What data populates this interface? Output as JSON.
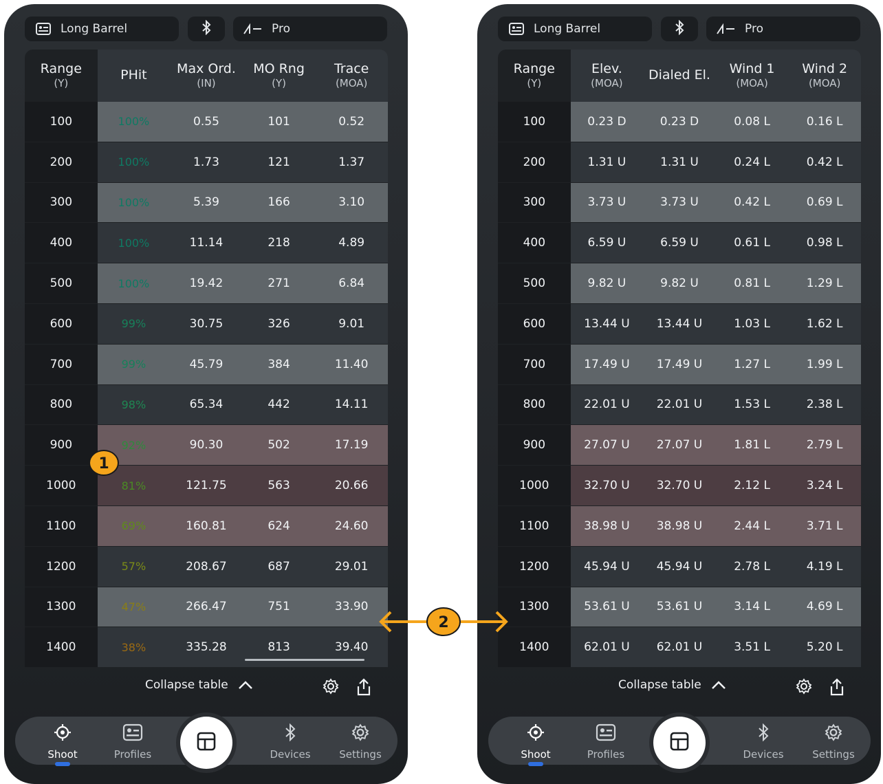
{
  "left_phone": {
    "topbar": {
      "profile": "Long Barrel",
      "device": "Pro"
    },
    "table": {
      "headers": [
        {
          "main": "Range",
          "unit": "(Y)"
        },
        {
          "main": "PHit",
          "unit": ""
        },
        {
          "main": "Max Ord.",
          "unit": "(IN)"
        },
        {
          "main": "MO Rng",
          "unit": "(Y)"
        },
        {
          "main": "Trace",
          "unit": "(MOA)"
        }
      ],
      "rows": [
        [
          "100",
          "100%",
          "0.55",
          "101",
          "0.52"
        ],
        [
          "200",
          "100%",
          "1.73",
          "121",
          "1.37"
        ],
        [
          "300",
          "100%",
          "5.39",
          "166",
          "3.10"
        ],
        [
          "400",
          "100%",
          "11.14",
          "218",
          "4.89"
        ],
        [
          "500",
          "100%",
          "19.42",
          "271",
          "6.84"
        ],
        [
          "600",
          "99%",
          "30.75",
          "326",
          "9.01"
        ],
        [
          "700",
          "99%",
          "45.79",
          "384",
          "11.40"
        ],
        [
          "800",
          "98%",
          "65.34",
          "442",
          "14.11"
        ],
        [
          "900",
          "92%",
          "90.30",
          "502",
          "17.19"
        ],
        [
          "1000",
          "81%",
          "121.75",
          "563",
          "20.66"
        ],
        [
          "1100",
          "69%",
          "160.81",
          "624",
          "24.60"
        ],
        [
          "1200",
          "57%",
          "208.67",
          "687",
          "29.01"
        ],
        [
          "1300",
          "47%",
          "266.47",
          "751",
          "33.90"
        ],
        [
          "1400",
          "38%",
          "335.28",
          "813",
          "39.40"
        ]
      ]
    },
    "collapse_label": "Collapse table"
  },
  "right_phone": {
    "topbar": {
      "profile": "Long Barrel",
      "device": "Pro"
    },
    "table": {
      "headers": [
        {
          "main": "Range",
          "unit": "(Y)"
        },
        {
          "main": "Elev.",
          "unit": "(MOA)"
        },
        {
          "main": "Dialed El.",
          "unit": ""
        },
        {
          "main": "Wind 1",
          "unit": "(MOA)"
        },
        {
          "main": "Wind 2",
          "unit": "(MOA)"
        }
      ],
      "rows": [
        [
          "100",
          "0.23 D",
          "0.23 D",
          "0.08 L",
          "0.16 L"
        ],
        [
          "200",
          "1.31 U",
          "1.31 U",
          "0.24 L",
          "0.42 L"
        ],
        [
          "300",
          "3.73 U",
          "3.73 U",
          "0.42 L",
          "0.69 L"
        ],
        [
          "400",
          "6.59 U",
          "6.59 U",
          "0.61 L",
          "0.98 L"
        ],
        [
          "500",
          "9.82 U",
          "9.82 U",
          "0.81 L",
          "1.29 L"
        ],
        [
          "600",
          "13.44 U",
          "13.44 U",
          "1.03 L",
          "1.62 L"
        ],
        [
          "700",
          "17.49 U",
          "17.49 U",
          "1.27 L",
          "1.99 L"
        ],
        [
          "800",
          "22.01 U",
          "22.01 U",
          "1.53 L",
          "2.38 L"
        ],
        [
          "900",
          "27.07 U",
          "27.07 U",
          "1.81 L",
          "2.79 L"
        ],
        [
          "1000",
          "32.70 U",
          "32.70 U",
          "2.12 L",
          "3.24 L"
        ],
        [
          "1100",
          "38.98 U",
          "38.98 U",
          "2.44 L",
          "3.71 L"
        ],
        [
          "1200",
          "45.94 U",
          "45.94 U",
          "2.78 L",
          "4.19 L"
        ],
        [
          "1300",
          "53.61 U",
          "53.61 U",
          "3.14 L",
          "4.69 L"
        ],
        [
          "1400",
          "62.01 U",
          "62.01 U",
          "3.51 L",
          "5.20 L"
        ]
      ]
    },
    "collapse_label": "Collapse table"
  },
  "row_styles": [
    "light",
    "dark",
    "light",
    "dark",
    "light",
    "dark",
    "light",
    "dark",
    "red1",
    "red2",
    "red1",
    "dark",
    "light",
    "dark"
  ],
  "phit_colors": [
    "#0f7a63",
    "#0f7a63",
    "#0f7a63",
    "#0f7a63",
    "#0f7a63",
    "#17805a",
    "#17805a",
    "#1f8652",
    "#2f8a3c",
    "#4a8a24",
    "#5f8a1c",
    "#7a8a18",
    "#8a7e16",
    "#9a6a14"
  ],
  "nav": {
    "shoot": "Shoot",
    "profiles": "Profiles",
    "devices": "Devices",
    "settings": "Settings"
  },
  "callouts": {
    "one": "1",
    "two": "2"
  },
  "colors": {
    "accent_orange": "#f5a51c",
    "active_blue": "#2f6fe0"
  }
}
